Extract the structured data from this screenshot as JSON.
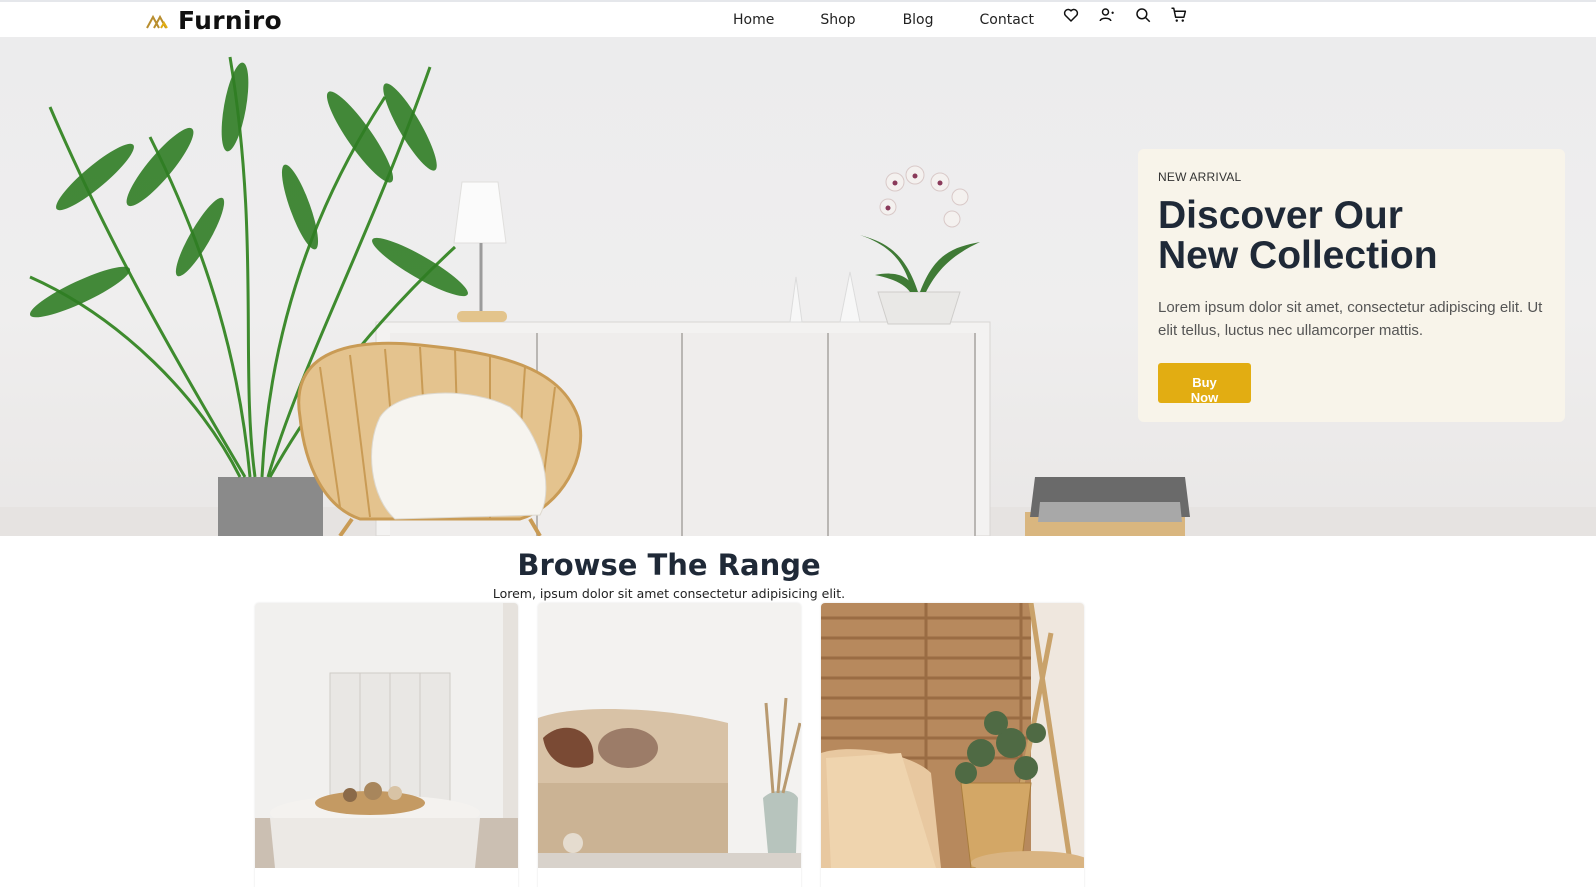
{
  "brand": {
    "name": "Furniro",
    "accent": "#e2ad12"
  },
  "nav": {
    "items": [
      "Home",
      "Shop",
      "Blog",
      "Contact"
    ]
  },
  "header_icons": [
    "heart-icon",
    "account-icon",
    "search-icon",
    "cart-icon"
  ],
  "hero": {
    "eyebrow": "NEW ARRIVAL",
    "title_line1": "Discover Our",
    "title_line2": "New Collection",
    "text": "Lorem ipsum dolor sit amet, consectetur adipiscing elit. Ut elit tellus, luctus nec ullamcorper mattis.",
    "cta": "Buy Now"
  },
  "browse": {
    "title": "Browse The Range",
    "subtitle": "Lorem, ipsum dolor sit amet consectetur adipisicing elit."
  }
}
